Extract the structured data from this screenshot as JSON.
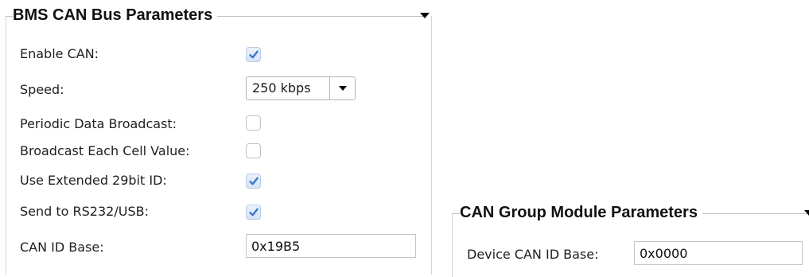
{
  "bms_can": {
    "title": "BMS CAN Bus Parameters",
    "enable_can": {
      "label": "Enable CAN:",
      "checked": true
    },
    "speed": {
      "label": "Speed:",
      "value": "250 kbps"
    },
    "periodic_broadcast": {
      "label": "Periodic Data Broadcast:",
      "checked": false
    },
    "broadcast_cell": {
      "label": "Broadcast Each Cell Value:",
      "checked": false
    },
    "extended_id": {
      "label": "Use Extended 29bit ID:",
      "checked": true
    },
    "send_rs232": {
      "label": "Send to RS232/USB:",
      "checked": true
    },
    "can_id_base": {
      "label": "CAN ID Base:",
      "value": "0x19B5"
    }
  },
  "can_group": {
    "title": "CAN Group Module Parameters",
    "device_can_id_base": {
      "label": "Device CAN ID Base:",
      "value": "0x0000"
    }
  },
  "icons": {
    "checkmark": "checkmark-icon",
    "collapse": "chevron-down-icon",
    "dropdown": "dropdown-arrow-icon"
  },
  "colors": {
    "checkmark": "#3a78c9",
    "checked_box_bg": "#dde9f8",
    "group_border": "#d5d5d5"
  }
}
